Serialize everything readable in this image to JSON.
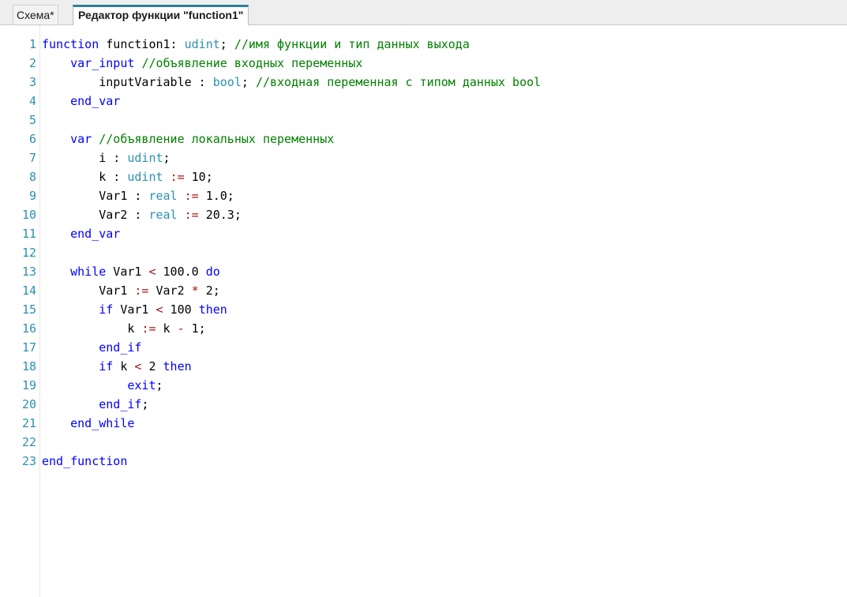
{
  "tabs": [
    {
      "label": "Схема*",
      "active": false
    },
    {
      "label": "Редактор функции \"function1\"",
      "active": true
    }
  ],
  "colors": {
    "keyword": "#0000ff",
    "type": "#2b91af",
    "comment": "#008000",
    "operator": "#a31515",
    "text": "#000000",
    "line_number": "#2b91af",
    "active_tab_accent": "#2d7f9b"
  },
  "editor": {
    "lines": [
      {
        "number": "1",
        "tokens": [
          [
            "kw",
            "function"
          ],
          [
            "tx",
            " function1: "
          ],
          [
            "ty",
            "udint"
          ],
          [
            "tx",
            "; "
          ],
          [
            "cm",
            "//имя функции и тип данных выхода"
          ]
        ]
      },
      {
        "number": "2",
        "tokens": [
          [
            "tx",
            "    "
          ],
          [
            "kw",
            "var_input"
          ],
          [
            "tx",
            " "
          ],
          [
            "cm",
            "//объявление входных переменных"
          ]
        ]
      },
      {
        "number": "3",
        "tokens": [
          [
            "tx",
            "        inputVariable : "
          ],
          [
            "ty",
            "bool"
          ],
          [
            "tx",
            "; "
          ],
          [
            "cm",
            "//входная переменная с типом данных bool"
          ]
        ]
      },
      {
        "number": "4",
        "tokens": [
          [
            "tx",
            "    "
          ],
          [
            "kw",
            "end_var"
          ]
        ]
      },
      {
        "number": "5",
        "tokens": []
      },
      {
        "number": "6",
        "tokens": [
          [
            "tx",
            "    "
          ],
          [
            "kw",
            "var"
          ],
          [
            "tx",
            " "
          ],
          [
            "cm",
            "//объявление локальных переменных"
          ]
        ]
      },
      {
        "number": "7",
        "tokens": [
          [
            "tx",
            "        i : "
          ],
          [
            "ty",
            "udint"
          ],
          [
            "tx",
            ";"
          ]
        ]
      },
      {
        "number": "8",
        "tokens": [
          [
            "tx",
            "        k : "
          ],
          [
            "ty",
            "udint"
          ],
          [
            "tx",
            " "
          ],
          [
            "op",
            ":="
          ],
          [
            "tx",
            " 10;"
          ]
        ]
      },
      {
        "number": "9",
        "tokens": [
          [
            "tx",
            "        Var1 : "
          ],
          [
            "ty",
            "real"
          ],
          [
            "tx",
            " "
          ],
          [
            "op",
            ":="
          ],
          [
            "tx",
            " 1.0;"
          ]
        ]
      },
      {
        "number": "10",
        "tokens": [
          [
            "tx",
            "        Var2 : "
          ],
          [
            "ty",
            "real"
          ],
          [
            "tx",
            " "
          ],
          [
            "op",
            ":="
          ],
          [
            "tx",
            " 20.3;"
          ]
        ]
      },
      {
        "number": "11",
        "tokens": [
          [
            "tx",
            "    "
          ],
          [
            "kw",
            "end_var"
          ]
        ]
      },
      {
        "number": "12",
        "tokens": []
      },
      {
        "number": "13",
        "tokens": [
          [
            "tx",
            "    "
          ],
          [
            "kw",
            "while"
          ],
          [
            "tx",
            " Var1 "
          ],
          [
            "op",
            "<"
          ],
          [
            "tx",
            " 100.0 "
          ],
          [
            "kw",
            "do"
          ]
        ]
      },
      {
        "number": "14",
        "tokens": [
          [
            "tx",
            "        Var1 "
          ],
          [
            "op",
            ":="
          ],
          [
            "tx",
            " Var2 "
          ],
          [
            "op",
            "*"
          ],
          [
            "tx",
            " 2;"
          ]
        ]
      },
      {
        "number": "15",
        "tokens": [
          [
            "tx",
            "        "
          ],
          [
            "kw",
            "if"
          ],
          [
            "tx",
            " Var1 "
          ],
          [
            "op",
            "<"
          ],
          [
            "tx",
            " 100 "
          ],
          [
            "kw",
            "then"
          ]
        ]
      },
      {
        "number": "16",
        "tokens": [
          [
            "tx",
            "            k "
          ],
          [
            "op",
            ":="
          ],
          [
            "tx",
            " k "
          ],
          [
            "op",
            "-"
          ],
          [
            "tx",
            " 1;"
          ]
        ]
      },
      {
        "number": "17",
        "tokens": [
          [
            "tx",
            "        "
          ],
          [
            "kw",
            "end_if"
          ]
        ]
      },
      {
        "number": "18",
        "tokens": [
          [
            "tx",
            "        "
          ],
          [
            "kw",
            "if"
          ],
          [
            "tx",
            " k "
          ],
          [
            "op",
            "<"
          ],
          [
            "tx",
            " 2 "
          ],
          [
            "kw",
            "then"
          ]
        ]
      },
      {
        "number": "19",
        "tokens": [
          [
            "tx",
            "            "
          ],
          [
            "kw",
            "exit"
          ],
          [
            "tx",
            ";"
          ]
        ]
      },
      {
        "number": "20",
        "tokens": [
          [
            "tx",
            "        "
          ],
          [
            "kw",
            "end_if"
          ],
          [
            "tx",
            ";"
          ]
        ]
      },
      {
        "number": "21",
        "tokens": [
          [
            "tx",
            "    "
          ],
          [
            "kw",
            "end_while"
          ]
        ]
      },
      {
        "number": "22",
        "tokens": []
      },
      {
        "number": "23",
        "tokens": [
          [
            "kw",
            "end_function"
          ]
        ]
      }
    ]
  }
}
